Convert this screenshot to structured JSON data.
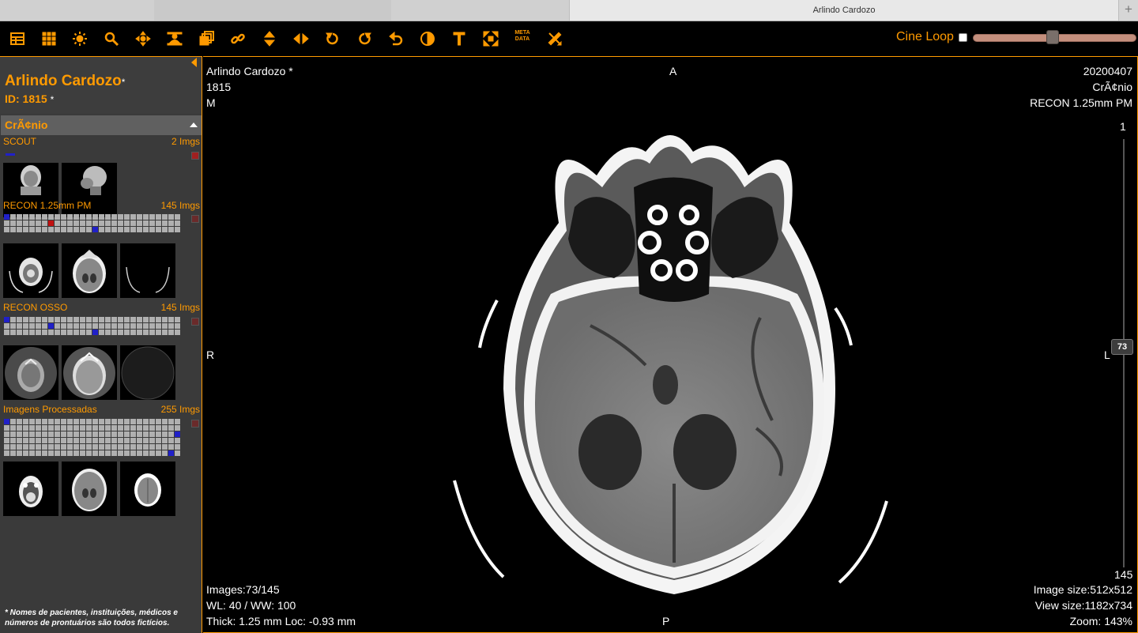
{
  "browser": {
    "tab_title": "Arlindo Cardozo",
    "new_tab": "+"
  },
  "toolbar": {
    "tools": [
      "layout-icon",
      "grid-icon",
      "brightness-icon",
      "zoom-icon",
      "pan-icon",
      "stack-icon",
      "series-icon",
      "link-icon",
      "scroll-vertical-icon",
      "scroll-horizontal-icon",
      "rotate-left-icon",
      "rotate-right-icon",
      "undo-icon",
      "invert-icon",
      "text-icon",
      "fullscreen-icon",
      "metadata-icon",
      "measure-icon"
    ],
    "meta_label_1": "META",
    "meta_label_2": "DATA",
    "cine_loop_label": "Cine Loop",
    "cine_loop_checked": false,
    "cine_speed": 0.45
  },
  "patient": {
    "name": "Arlindo Cardozo",
    "name_mark": "*",
    "id_label": "ID: 1815",
    "id_mark": "*"
  },
  "study": {
    "title": "CrÃ¢nio"
  },
  "series": [
    {
      "label": "SCOUT",
      "count": "2 Imgs"
    },
    {
      "label": "RECON 1.25mm PM",
      "count": "145 Imgs"
    },
    {
      "label": "RECON OSSO",
      "count": "145 Imgs"
    },
    {
      "label": "Imagens Processadas",
      "count": "255 Imgs"
    }
  ],
  "disclaimer": "* Nomes de pacientes, instituições, médicos e números de prontuários são todos fictícios.",
  "overlay": {
    "top_left_name": "Arlindo Cardozo *",
    "top_left_id": "1815",
    "top_left_sex": "M",
    "top_center": "A",
    "top_right_date": "20200407",
    "top_right_study": "CrÃ¢nio",
    "top_right_series": "RECON 1.25mm PM",
    "left_orient": "R",
    "right_orient": "L",
    "bottom_center": "P",
    "scroll_top": "1",
    "scroll_bottom": "145",
    "scroll_current": "73",
    "images": "Images:73/145",
    "wl": "WL: 40 / WW: 100",
    "thick": "Thick: 1.25 mm Loc: -0.93 mm",
    "image_size": "Image size:512x512",
    "view_size": "View size:1182x734",
    "zoom": "Zoom: 143%"
  }
}
